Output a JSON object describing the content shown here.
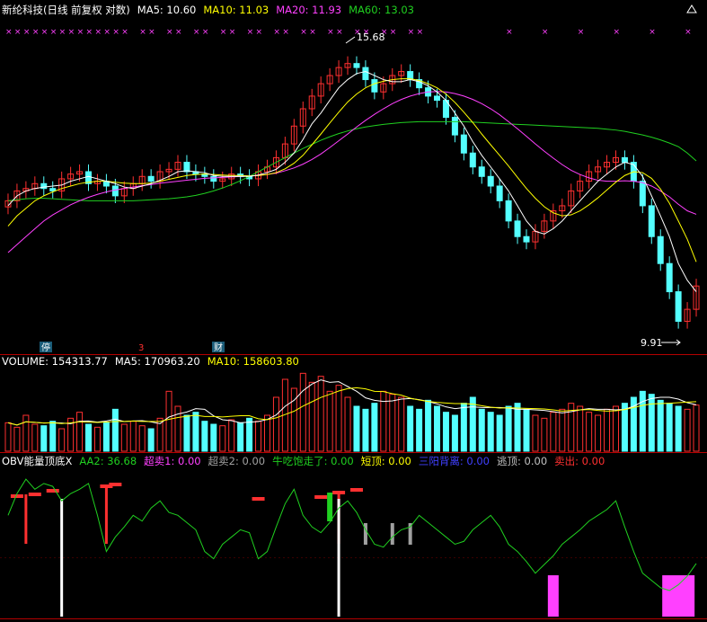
{
  "colors": {
    "background": "#000000",
    "up": "#ff3030",
    "down": "#54ffff",
    "ma5": "#ffffff",
    "ma10": "#ffff00",
    "ma20": "#ff40ff",
    "ma60": "#20d020",
    "divider": "#b40000",
    "obv_line": "#20d020",
    "marker": "#ff40ff"
  },
  "header": {
    "title": "新纶科技(日线 前复权 对数)",
    "ma5": "MA5: 10.60",
    "ma10": "MA10: 11.03",
    "ma20": "MA20: 11.93",
    "ma60": "MA60: 13.03"
  },
  "price_panel": {
    "high_label": "15.68",
    "low_label": "9.91",
    "events": [
      "停",
      "3",
      "财"
    ]
  },
  "volume_panel": {
    "volume": "VOLUME: 154313.77",
    "ma5": "MA5: 170963.20",
    "ma10": "MA10: 158603.80"
  },
  "obv_panel": {
    "name": "OBV能量顶底X",
    "aa2": "AA2: 36.68",
    "chaomai1": "超卖1: 0.00",
    "chaomai2": "超卖2: 0.00",
    "niuchibao": "牛吃饱走了: 0.00",
    "duanding": "短顶: 0.00",
    "sanyang": "三阳背离: 0.00",
    "taoding": "逃顶: 0.00",
    "maichu": "卖出: 0.00"
  },
  "chart_data": [
    {
      "type": "candlestick",
      "title": "新纶科技(日线 前复权 对数)",
      "y_scale": "log",
      "ylim": [
        9.6,
        16.3
      ],
      "annotations": {
        "high": 15.68,
        "low": 9.91
      },
      "close": [
        12.2,
        12.4,
        12.45,
        12.55,
        12.45,
        12.4,
        12.65,
        12.75,
        12.8,
        12.55,
        12.6,
        12.5,
        12.3,
        12.45,
        12.55,
        12.7,
        12.6,
        12.8,
        12.85,
        13.0,
        12.8,
        12.75,
        12.7,
        12.6,
        12.65,
        12.75,
        12.7,
        12.65,
        12.8,
        12.9,
        13.1,
        13.4,
        13.8,
        14.2,
        14.5,
        14.8,
        15.0,
        15.2,
        15.3,
        15.2,
        14.9,
        14.6,
        14.8,
        15.0,
        15.1,
        14.9,
        14.7,
        14.5,
        14.4,
        14.0,
        13.6,
        13.2,
        12.9,
        12.7,
        12.5,
        12.2,
        11.8,
        11.5,
        11.4,
        11.6,
        11.8,
        12.0,
        12.1,
        12.4,
        12.6,
        12.8,
        12.9,
        13.0,
        13.1,
        13.0,
        12.6,
        12.1,
        11.5,
        11.0,
        10.5,
        10.0,
        10.2,
        10.6
      ],
      "ma5": [
        12.1,
        12.3,
        12.4,
        12.45,
        12.48,
        12.5,
        12.52,
        12.6,
        12.65,
        12.7,
        12.65,
        12.6,
        12.55,
        12.48,
        12.45,
        12.5,
        12.55,
        12.62,
        12.7,
        12.8,
        12.82,
        12.8,
        12.78,
        12.72,
        12.7,
        12.7,
        12.7,
        12.7,
        12.73,
        12.78,
        12.85,
        13.0,
        13.2,
        13.5,
        13.85,
        14.1,
        14.4,
        14.7,
        14.9,
        15.05,
        15.1,
        15.0,
        14.9,
        14.85,
        14.85,
        14.9,
        14.85,
        14.75,
        14.6,
        14.4,
        14.1,
        13.8,
        13.45,
        13.15,
        12.9,
        12.65,
        12.4,
        12.1,
        11.8,
        11.6,
        11.55,
        11.65,
        11.8,
        12.0,
        12.2,
        12.4,
        12.6,
        12.75,
        12.9,
        13.0,
        12.95,
        12.7,
        12.3,
        11.9,
        11.5,
        11.0,
        10.7,
        10.5
      ],
      "ma10": [
        11.7,
        11.9,
        12.05,
        12.2,
        12.3,
        12.38,
        12.45,
        12.5,
        12.55,
        12.58,
        12.6,
        12.6,
        12.58,
        12.56,
        12.55,
        12.55,
        12.56,
        12.6,
        12.64,
        12.68,
        12.72,
        12.74,
        12.75,
        12.74,
        12.73,
        12.72,
        12.72,
        12.71,
        12.72,
        12.74,
        12.78,
        12.86,
        12.98,
        13.15,
        13.38,
        13.62,
        13.87,
        14.12,
        14.36,
        14.55,
        14.7,
        14.8,
        14.86,
        14.9,
        14.92,
        14.92,
        14.88,
        14.8,
        14.7,
        14.55,
        14.35,
        14.12,
        13.88,
        13.62,
        13.38,
        13.15,
        12.92,
        12.68,
        12.45,
        12.25,
        12.08,
        11.96,
        11.9,
        11.92,
        12.0,
        12.12,
        12.26,
        12.42,
        12.58,
        12.72,
        12.8,
        12.78,
        12.66,
        12.44,
        12.15,
        11.8,
        11.45,
        11.03
      ],
      "ma20": [
        11.2,
        11.35,
        11.5,
        11.65,
        11.8,
        11.92,
        12.02,
        12.12,
        12.2,
        12.27,
        12.33,
        12.38,
        12.42,
        12.45,
        12.48,
        12.51,
        12.53,
        12.56,
        12.58,
        12.6,
        12.62,
        12.64,
        12.66,
        12.67,
        12.68,
        12.69,
        12.7,
        12.71,
        12.72,
        12.74,
        12.77,
        12.82,
        12.88,
        12.96,
        13.06,
        13.18,
        13.32,
        13.47,
        13.62,
        13.78,
        13.93,
        14.07,
        14.2,
        14.32,
        14.42,
        14.5,
        14.56,
        14.6,
        14.61,
        14.6,
        14.56,
        14.5,
        14.42,
        14.32,
        14.2,
        14.06,
        13.9,
        13.74,
        13.57,
        13.4,
        13.24,
        13.09,
        12.95,
        12.83,
        12.74,
        12.67,
        12.62,
        12.6,
        12.6,
        12.61,
        12.6,
        12.57,
        12.5,
        12.4,
        12.28,
        12.13,
        12.0,
        11.93
      ],
      "ma60": [
        12.2,
        12.22,
        12.24,
        12.25,
        12.25,
        12.24,
        12.23,
        12.22,
        12.21,
        12.2,
        12.2,
        12.2,
        12.2,
        12.2,
        12.2,
        12.21,
        12.22,
        12.23,
        12.24,
        12.26,
        12.28,
        12.31,
        12.35,
        12.4,
        12.46,
        12.53,
        12.61,
        12.7,
        12.8,
        12.9,
        13.0,
        13.1,
        13.2,
        13.3,
        13.39,
        13.48,
        13.56,
        13.63,
        13.69,
        13.74,
        13.78,
        13.81,
        13.84,
        13.86,
        13.88,
        13.89,
        13.9,
        13.9,
        13.9,
        13.9,
        13.9,
        13.9,
        13.89,
        13.88,
        13.87,
        13.86,
        13.85,
        13.84,
        13.83,
        13.82,
        13.81,
        13.8,
        13.79,
        13.78,
        13.77,
        13.76,
        13.75,
        13.73,
        13.71,
        13.68,
        13.64,
        13.6,
        13.55,
        13.49,
        13.42,
        13.34,
        13.2,
        13.03
      ]
    },
    {
      "type": "bar",
      "title": "VOLUME",
      "values": [
        95,
        80,
        120,
        90,
        85,
        100,
        75,
        110,
        130,
        90,
        80,
        95,
        140,
        90,
        100,
        85,
        75,
        110,
        200,
        150,
        120,
        130,
        100,
        90,
        85,
        105,
        95,
        110,
        100,
        120,
        180,
        240,
        210,
        260,
        230,
        250,
        200,
        220,
        180,
        150,
        140,
        160,
        200,
        190,
        180,
        150,
        140,
        170,
        150,
        130,
        120,
        160,
        180,
        140,
        130,
        120,
        150,
        160,
        140,
        120,
        110,
        130,
        140,
        160,
        150,
        130,
        120,
        140,
        150,
        160,
        180,
        200,
        190,
        170,
        160,
        150,
        140,
        154
      ]
    },
    {
      "type": "line",
      "title": "OBV能量顶底X",
      "ylim": [
        0,
        100
      ],
      "values": [
        70,
        85,
        95,
        88,
        92,
        90,
        80,
        85,
        88,
        92,
        70,
        45,
        55,
        62,
        70,
        66,
        75,
        80,
        72,
        70,
        65,
        60,
        45,
        40,
        50,
        55,
        60,
        58,
        40,
        45,
        62,
        78,
        88,
        70,
        62,
        58,
        65,
        75,
        80,
        72,
        60,
        50,
        48,
        55,
        60,
        62,
        70,
        65,
        60,
        55,
        50,
        52,
        60,
        65,
        70,
        62,
        50,
        45,
        38,
        30,
        36,
        42,
        50,
        55,
        60,
        66,
        70,
        74,
        80,
        62,
        45,
        30,
        25,
        20,
        18,
        22,
        28,
        36.68
      ]
    }
  ]
}
